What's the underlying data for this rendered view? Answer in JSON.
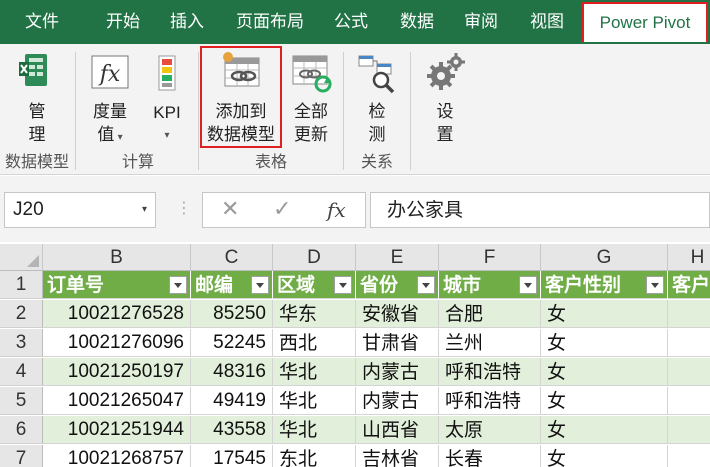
{
  "tabs": [
    "文件",
    "开始",
    "插入",
    "页面布局",
    "公式",
    "数据",
    "审阅",
    "视图",
    "Power Pivot"
  ],
  "ribbon": {
    "groups": [
      "数据模型",
      "计算",
      "表格",
      "关系"
    ],
    "buttons": {
      "manage": [
        "管",
        "理"
      ],
      "measures": [
        "度量",
        "值"
      ],
      "kpi": [
        "KPI"
      ],
      "add_to_model": [
        "添加到",
        "数据模型"
      ],
      "refresh_all": [
        "全部",
        "更新"
      ],
      "detect": [
        "检",
        "测"
      ],
      "settings": [
        "设",
        "置"
      ]
    }
  },
  "formula_bar": {
    "name_box": "J20",
    "fx": "fx",
    "value": "办公家具"
  },
  "colors": {
    "ribbon_green": "#217346",
    "table_header": "#70ad47",
    "table_band": "#e2efda",
    "highlight": "#e02020"
  },
  "grid": {
    "columns": [
      "B",
      "C",
      "D",
      "E",
      "F",
      "G",
      "H"
    ],
    "rows": [
      "1",
      "2",
      "3",
      "4",
      "5",
      "6",
      "7"
    ],
    "header": [
      "订单号",
      "邮编",
      "区域",
      "省份",
      "城市",
      "客户性别",
      "客户"
    ],
    "data": [
      [
        "10021276528",
        "85250",
        "华东",
        "安徽省",
        "合肥",
        "女"
      ],
      [
        "10021276096",
        "52245",
        "西北",
        "甘肃省",
        "兰州",
        "女"
      ],
      [
        "10021250197",
        "48316",
        "华北",
        "内蒙古",
        "呼和浩特",
        "女"
      ],
      [
        "10021265047",
        "49419",
        "华北",
        "内蒙古",
        "呼和浩特",
        "女"
      ],
      [
        "10021251944",
        "43558",
        "华北",
        "山西省",
        "太原",
        "女"
      ],
      [
        "10021268757",
        "17545",
        "东北",
        "吉林省",
        "长春",
        "女"
      ]
    ]
  }
}
